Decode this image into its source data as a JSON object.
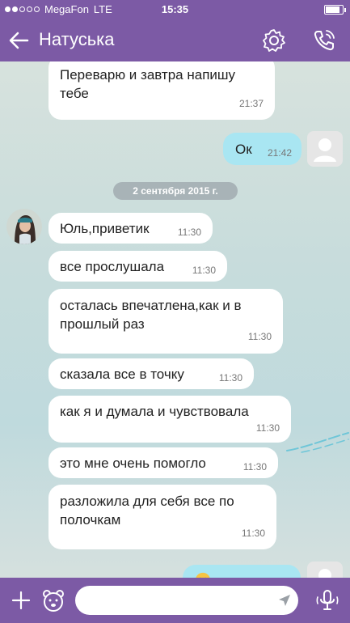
{
  "status_bar": {
    "carrier": "MegaFon",
    "network": "LTE",
    "time": "15:35",
    "signal_bars": 2,
    "battery_level": 0.85
  },
  "header": {
    "title": "Натуська"
  },
  "chat": {
    "date_separator": "2 сентября 2015 г.",
    "messages": [
      {
        "direction": "in",
        "text": "Переварю и завтра напишу тебе",
        "time": "21:37"
      },
      {
        "direction": "out",
        "text": "Ок",
        "time": "21:42"
      },
      {
        "direction": "in",
        "text": "Юль,приветик",
        "time": "11:30"
      },
      {
        "direction": "in",
        "text": "все прослушала",
        "time": "11:30"
      },
      {
        "direction": "in",
        "text": "осталась впечатлена,как и в прошлый раз",
        "time": "11:30"
      },
      {
        "direction": "in",
        "text": "сказала все в точку",
        "time": "11:30"
      },
      {
        "direction": "in",
        "text": "как я и думала и чувствовала",
        "time": "11:30"
      },
      {
        "direction": "in",
        "text": "это мне очень помогло",
        "time": "11:30"
      },
      {
        "direction": "in",
        "text": "разложила для себя все по полочкам",
        "time": "11:30"
      }
    ]
  },
  "colors": {
    "brand": "#7c5aa5",
    "outgoing_bubble": "#a9e6f2",
    "incoming_bubble": "#ffffff",
    "date_pill": "#a8b3b7"
  },
  "icons": {
    "back": "back-arrow-icon",
    "settings": "gear-icon",
    "call": "phone-icon",
    "add": "plus-icon",
    "stickers": "bear-icon",
    "send": "send-icon",
    "voice": "microphone-icon"
  }
}
